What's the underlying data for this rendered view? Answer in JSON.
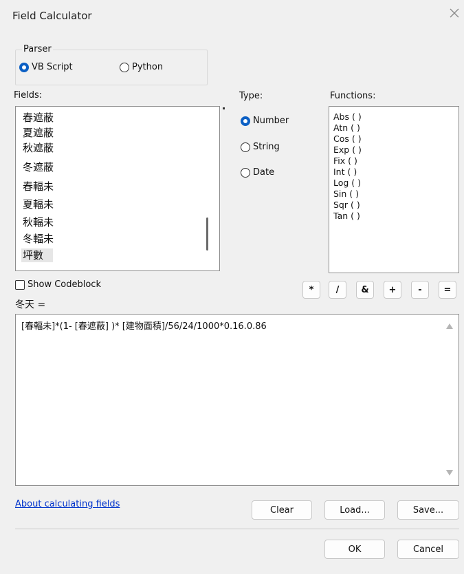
{
  "window": {
    "title": "Field Calculator",
    "close_glyph": "✕"
  },
  "parser": {
    "legend": "Parser",
    "options": [
      {
        "label": "VB Script",
        "selected": true
      },
      {
        "label": "Python",
        "selected": false
      }
    ]
  },
  "fields": {
    "label": "Fields:",
    "items": [
      "春遮蔽",
      "夏遮蔽",
      "秋遮蔽",
      "冬遮蔽",
      "春輻未",
      "夏輻未",
      "秋輻未",
      "冬輻未",
      "坪數"
    ],
    "selected_index": 8
  },
  "type": {
    "label": "Type:",
    "options": [
      {
        "label": "Number",
        "selected": true
      },
      {
        "label": "String",
        "selected": false
      },
      {
        "label": "Date",
        "selected": false
      }
    ]
  },
  "functions": {
    "label": "Functions:",
    "items": [
      "Abs ( )",
      "Atn ( )",
      "Cos ( )",
      "Exp ( )",
      "Fix ( )",
      "Int ( )",
      "Log ( )",
      "Sin ( )",
      "Sqr ( )",
      "Tan ( )"
    ]
  },
  "codeblock": {
    "label": "Show Codeblock",
    "checked": false
  },
  "operators": [
    "*",
    "/",
    "&",
    "+",
    "-",
    "="
  ],
  "expression": {
    "label": "冬天 =",
    "value": "[春輻未]*(1- [春遮蔽] )* [建物面積]/56/24/1000*0.16.0.86"
  },
  "link": "About calculating fields",
  "buttons": {
    "clear": "Clear",
    "load": "Load...",
    "save": "Save...",
    "ok": "OK",
    "cancel": "Cancel"
  },
  "colors": {
    "accent": "#0b5fc4",
    "link": "#0033cc",
    "background": "#f0f0f0"
  }
}
